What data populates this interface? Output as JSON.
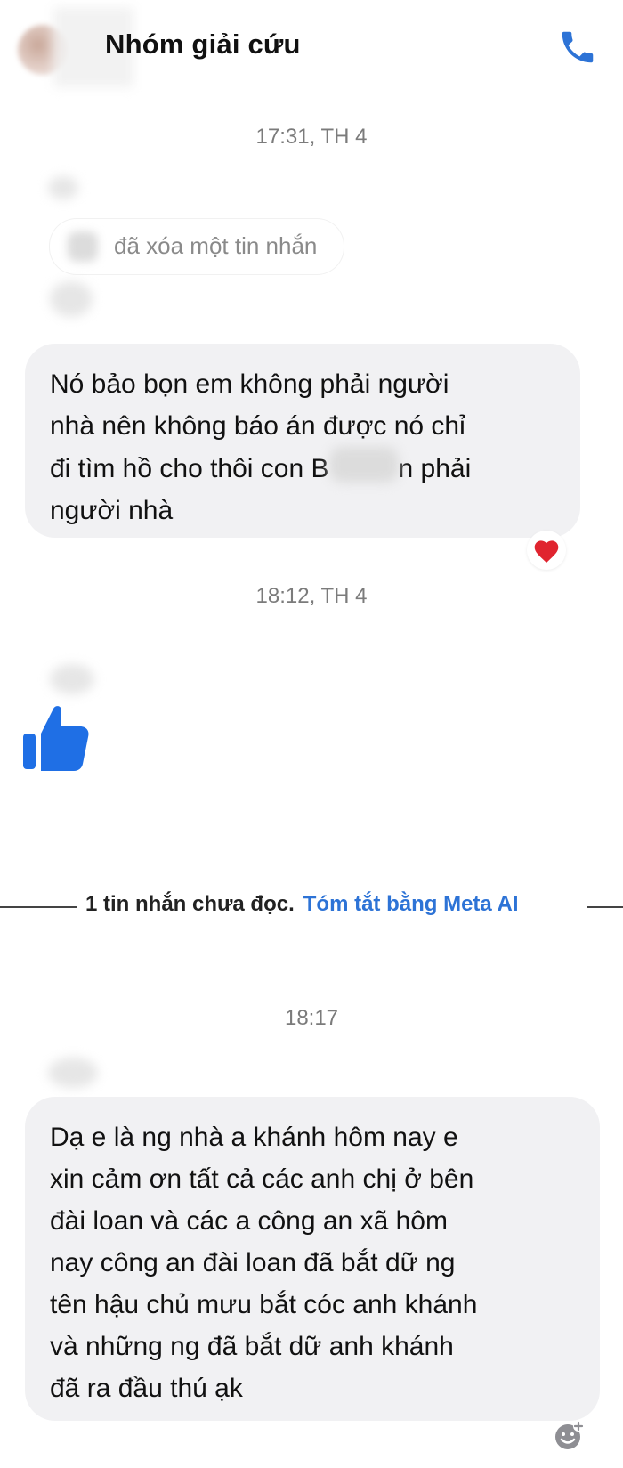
{
  "header": {
    "title": "Nhóm giải cứu",
    "call_icon": "phone-icon"
  },
  "messages": {
    "timestamp_1": "17:31, TH 4",
    "deleted_text": "đã xóa một tin nhắn",
    "msg1_lines": [
      "Nó bảo bọn em không phải người",
      "nhà nên không báo án được nó chỉ",
      "đi tìm hồ cho thôi con B",
      "n phải",
      "người nhà"
    ],
    "reaction_icon": "heart-icon",
    "timestamp_2": "18:12, TH 4",
    "sticker_icon": "thumbs-up-icon",
    "unread_text": "1 tin nhắn chưa đọc.",
    "meta_link": "Tóm tắt bằng Meta AI",
    "timestamp_3": "18:17",
    "msg2_lines": [
      "Dạ e là ng nhà a khánh hôm nay e",
      "xin cảm ơn tất cả các anh chị ở bên",
      "đài loan và các a công an xã hôm",
      "nay công an đài loan đã bắt dữ ng",
      "tên hậu chủ mưu bắt cóc anh khánh",
      "và những ng đã bắt dữ anh khánh",
      "đã ra đầu thú ạk"
    ],
    "add_reaction_icon": "add-reaction-icon"
  },
  "colors": {
    "bubble": "#f1f1f3",
    "accent_blue": "#2d73d6",
    "heart": "#e0242f"
  }
}
